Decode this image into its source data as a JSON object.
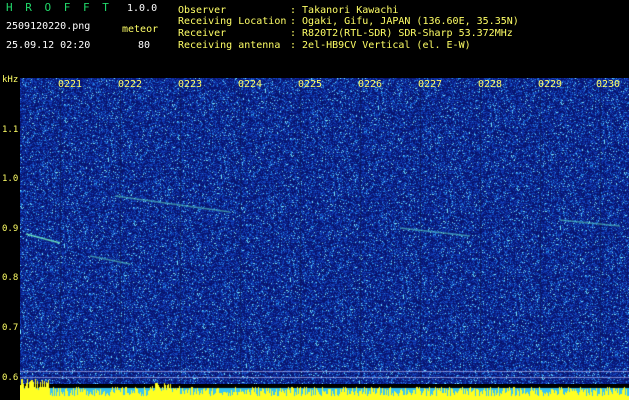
{
  "header": {
    "app_title": "H R O F F T",
    "version": "1.0.0",
    "filename": "2509120220.png",
    "datetime": "25.09.12 02:20",
    "event_label": "meteor",
    "event_count": "80",
    "info": [
      {
        "key": "Observer",
        "value": ": Takanori Kawachi"
      },
      {
        "key": "Receiving Location",
        "value": ": Ogaki, Gifu, JAPAN (136.60E, 35.35N)"
      },
      {
        "key": "Receiver",
        "value": ": R820T2(RTL-SDR) SDR-Sharp 53.372MHz"
      },
      {
        "key": "Receiving antenna",
        "value": ": 2el-HB9CV Vertical (el. E-W)"
      }
    ]
  },
  "spectrogram": {
    "y_unit": "kHz",
    "y_ticks": [
      "1.1",
      "1.0",
      "0.9",
      "0.8",
      "0.7",
      "0.6"
    ],
    "time_ticks": [
      "0221",
      "0222",
      "0223",
      "0224",
      "0225",
      "0226",
      "0227",
      "0228",
      "0229",
      "0230"
    ]
  },
  "colors": {
    "background": "#000000",
    "spectrum_base": "#0b1a7a",
    "noise_cyan": "#3fd0ff",
    "bottom_bar": "#37c4f0",
    "text_yellow": "#ffff66",
    "text_green": "#21d96a"
  }
}
